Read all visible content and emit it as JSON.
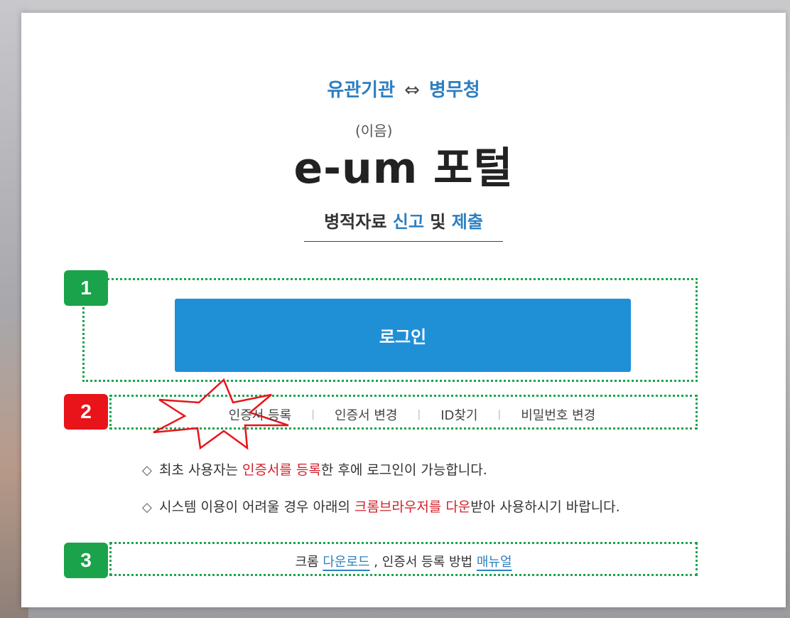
{
  "header": {
    "org_left": "유관기관",
    "arrow": "⇔",
    "org_right": "병무청",
    "pronunciation": "(이음)",
    "title": "e-um 포털",
    "tagline_pre": "병적자료",
    "tagline_hl1": "신고",
    "tagline_mid": "및",
    "tagline_hl2": "제출"
  },
  "markers": [
    "1",
    "2",
    "3"
  ],
  "login": {
    "label": "로그인"
  },
  "links": [
    {
      "label": "인증서 등록"
    },
    {
      "label": "인증서 변경"
    },
    {
      "label": "ID찾기"
    },
    {
      "label": "비밀번호 변경"
    }
  ],
  "link_separator": "|",
  "notices": [
    {
      "pre": "최초 사용자는 ",
      "hl": "인증서를 등록",
      "post": "한 후에 로그인이 가능합니다."
    },
    {
      "pre": "시스템 이용이 어려울 경우 아래의 ",
      "hl": "크롬브라우저를 다운",
      "post": "받아 사용하시기 바랍니다."
    }
  ],
  "notice_icon": "◇",
  "bottom": {
    "chrome": "크롬",
    "download": "다운로드",
    "mid": ", 인증서 등록 방법",
    "manual": "매뉴얼"
  },
  "colors": {
    "accent": "#2d7fc1",
    "button": "#1f8fd6",
    "highlight": "#d4202a",
    "marker_green": "#1aa34a",
    "marker_red": "#e8141a"
  }
}
